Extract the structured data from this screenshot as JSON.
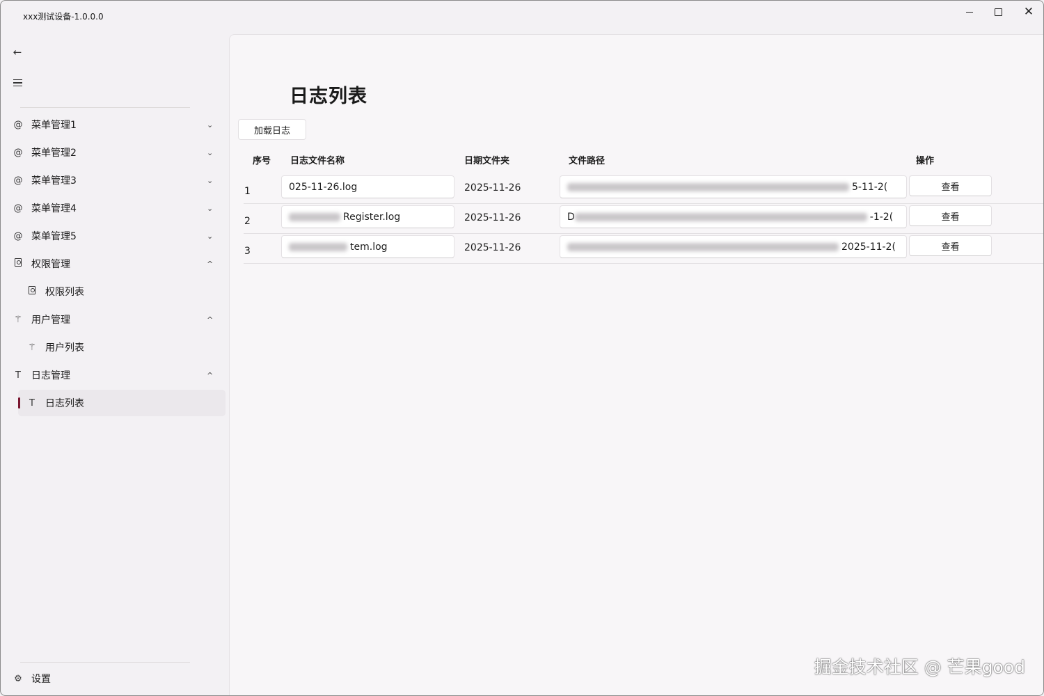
{
  "window": {
    "title": "xxx测试设备-1.0.0.0",
    "controls": {
      "minimize": "",
      "maximize": "",
      "close": "✕"
    }
  },
  "sidebar": {
    "back_icon": "←",
    "items": [
      {
        "icon": "@",
        "label": "菜单管理1",
        "chevron": "⌄"
      },
      {
        "icon": "@",
        "label": "菜单管理2",
        "chevron": "⌄"
      },
      {
        "icon": "@",
        "label": "菜单管理3",
        "chevron": "⌄"
      },
      {
        "icon": "@",
        "label": "菜单管理4",
        "chevron": "⌄"
      },
      {
        "icon": "@",
        "label": "菜单管理5",
        "chevron": "⌄"
      },
      {
        "icon": "doc",
        "label": "权限管理",
        "chevron": "^"
      },
      {
        "icon": "doc",
        "label": "权限列表",
        "sub": true
      },
      {
        "icon": "⚚",
        "label": "用户管理",
        "chevron": "^"
      },
      {
        "icon": "⚚",
        "label": "用户列表",
        "sub": true
      },
      {
        "icon": "T",
        "label": "日志管理",
        "chevron": "^"
      },
      {
        "icon": "T",
        "label": "日志列表",
        "sub": true,
        "selected": true
      }
    ],
    "settings": {
      "icon": "⚙",
      "label": "设置"
    },
    "accent_color": "#7a1630"
  },
  "main": {
    "page_title": "日志列表",
    "load_button": "加载日志",
    "table": {
      "headers": [
        "序号",
        "日志文件名称",
        "日期文件夹",
        "文件路径",
        "操作"
      ],
      "rows": [
        {
          "index": "1",
          "name": "025-11-26.log",
          "date": "2025-11-26",
          "path": "5-11-2(",
          "action": "查看"
        },
        {
          "index": "2",
          "name": "Register.log",
          "date": "2025-11-26",
          "path": "D",
          "path_tail": "-1-2(",
          "action": "查看"
        },
        {
          "index": "3",
          "name": "tem.log",
          "date": "2025-11-26",
          "path": "2025-11-2(",
          "action": "查看"
        }
      ]
    }
  },
  "watermark": "掘金技术社区 @ 芒果good"
}
